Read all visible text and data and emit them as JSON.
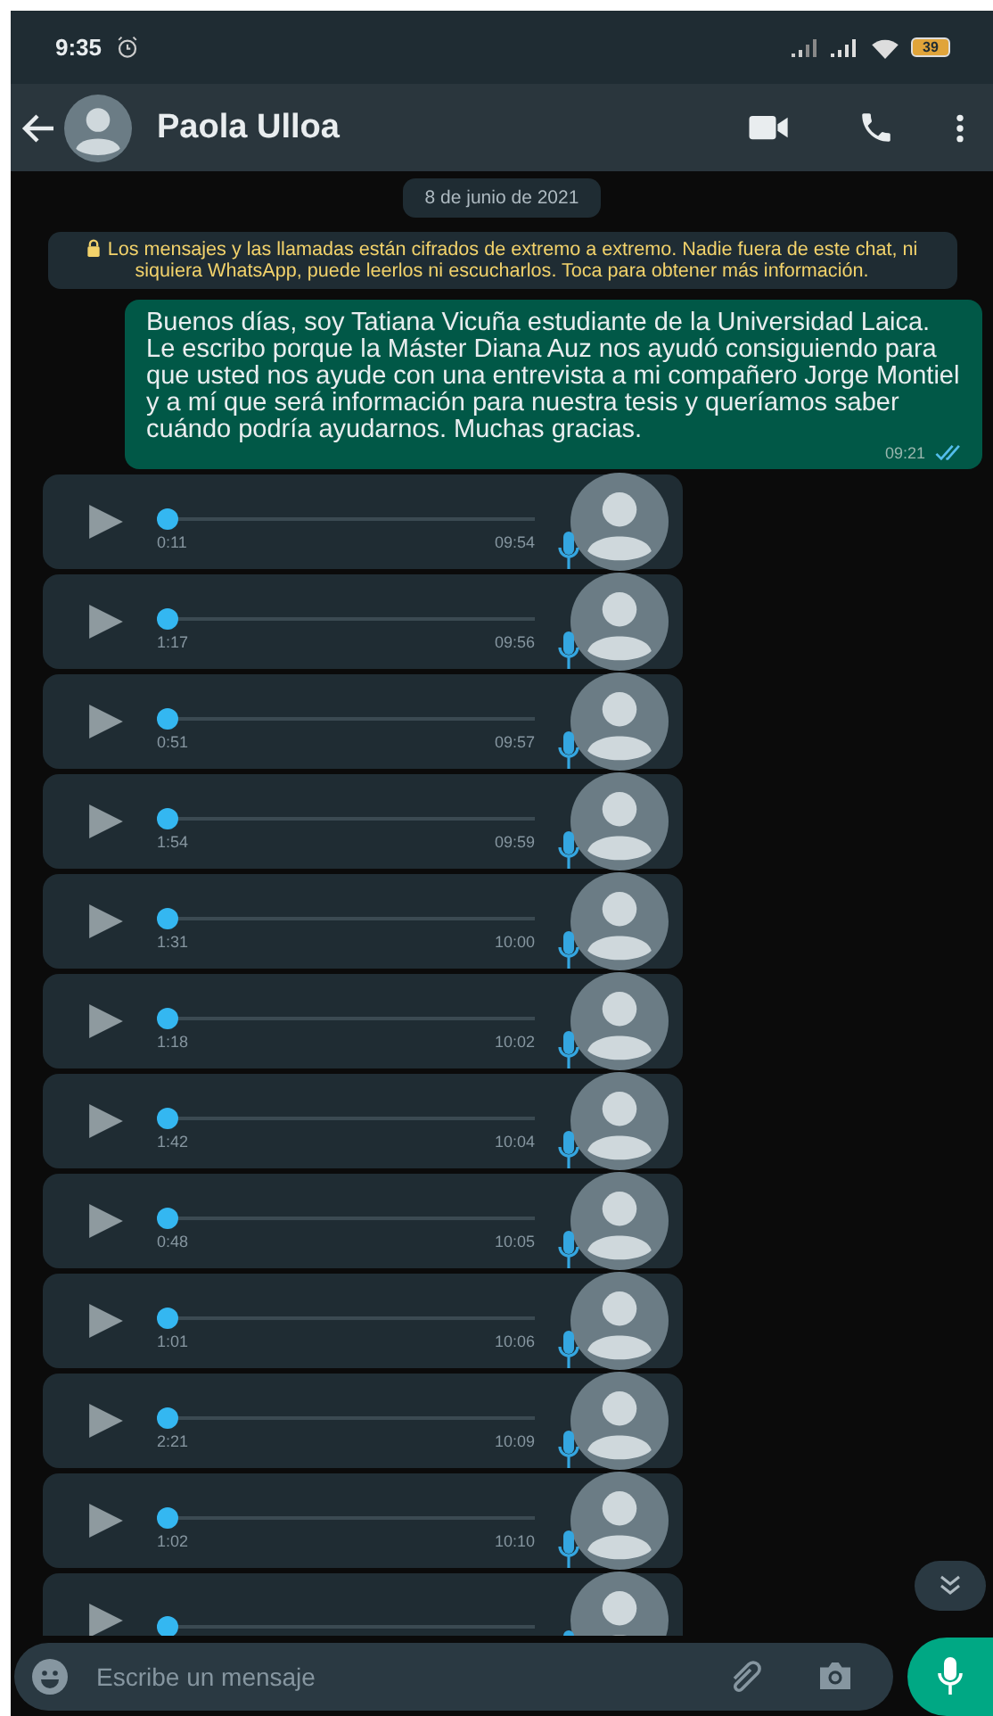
{
  "status_bar": {
    "time": "9:35",
    "battery": "39"
  },
  "header": {
    "contact_name": "Paola Ulloa"
  },
  "date_divider": "8 de junio de 2021",
  "encryption_notice": "Los mensajes y las llamadas están cifrados de extremo a extremo. Nadie fuera de este chat, ni siquiera WhatsApp, puede leerlos ni escucharlos. Toca para obtener más información.",
  "outgoing_message": {
    "text": "Buenos días, soy Tatiana Vicuña estudiante de la Universidad Laica. Le escribo porque la Máster Diana Auz nos ayudó consiguiendo para que usted nos ayude con una entrevista a mi compañero Jorge Montiel y a mí que será información para nuestra tesis y queríamos saber cuándo podría ayudarnos. Muchas gracias.",
    "time": "09:21",
    "read": true
  },
  "voice_messages": [
    {
      "duration": "0:11",
      "time": "09:54",
      "level": 0
    },
    {
      "duration": "1:17",
      "time": "09:56",
      "level": 0
    },
    {
      "duration": "0:51",
      "time": "09:57",
      "level": 0
    },
    {
      "duration": "1:54",
      "time": "09:59",
      "level": 0
    },
    {
      "duration": "1:31",
      "time": "10:00",
      "level": 0
    },
    {
      "duration": "1:18",
      "time": "10:02",
      "level": 0
    },
    {
      "duration": "1:42",
      "time": "10:04",
      "level": 0
    },
    {
      "duration": "0:48",
      "time": "10:05",
      "level": 0
    },
    {
      "duration": "1:01",
      "time": "10:06",
      "level": 0
    },
    {
      "duration": "2:21",
      "time": "10:09",
      "level": 0
    },
    {
      "duration": "1:02",
      "time": "10:10",
      "level": 0
    },
    {
      "level": 0
    }
  ],
  "composer": {
    "placeholder": "Escribe un mensaje"
  }
}
